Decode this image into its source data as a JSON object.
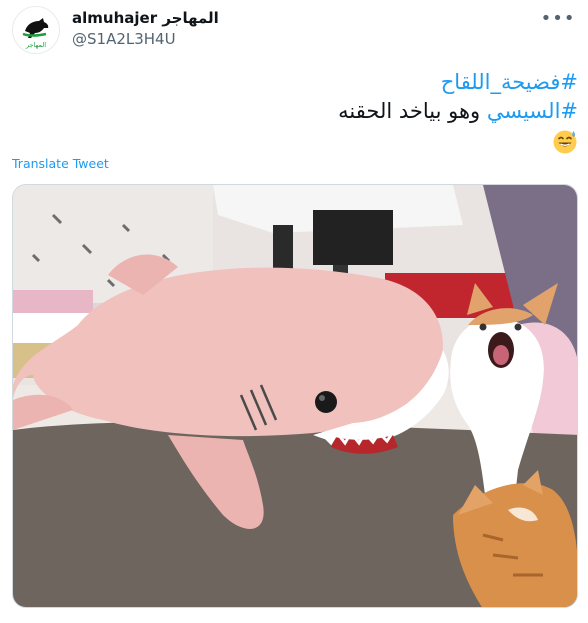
{
  "author": {
    "display_name": "almuhajer المهاجر",
    "handle": "@S1A2L3H4U",
    "avatar_icon": "horse-logo-icon",
    "avatar_label": "المهاجر"
  },
  "tweet": {
    "hashtag_1": "#فضيحة_اللقاح",
    "hashtag_2": "#السيسي",
    "text_after_hashtag_2": " وهو بياخد الحقنه",
    "emoji": "sweat-smile-emoji"
  },
  "actions": {
    "more_icon": "more-dots-icon",
    "more_glyph": "•••",
    "translate_label": "Translate Tweet"
  },
  "media": {
    "type": "photo",
    "icon": "photo-shark-plush-cats"
  },
  "colors": {
    "link": "#1d9bf0",
    "text": "#0f1419",
    "secondary": "#536471",
    "border": "#cfd9de"
  }
}
